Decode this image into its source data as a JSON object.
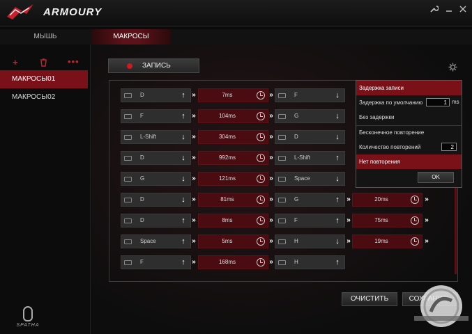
{
  "app": {
    "title": "ARMOURY"
  },
  "titlebar": {
    "tools_icon": "wrench-icon",
    "minimize_icon": "minimize-icon",
    "close_icon": "close-icon"
  },
  "tabs": [
    {
      "label": "МЫШЬ"
    },
    {
      "label": "МАКРОСЫ"
    }
  ],
  "sidebar": {
    "add_icon": "plus-icon",
    "delete_icon": "trash-icon",
    "more_icon": "more-dots-icon",
    "items": [
      {
        "label": "МАКРОСЫ01"
      },
      {
        "label": "МАКРОСЫ02"
      }
    ]
  },
  "record": {
    "label": "ЗАПИСЬ"
  },
  "events": [
    [
      {
        "key": "D",
        "dir": "up"
      },
      {
        "delay": "7ms"
      },
      {
        "key": "F",
        "dir": "down"
      }
    ],
    [
      {
        "key": "F",
        "dir": "up"
      },
      {
        "delay": "104ms"
      },
      {
        "key": "G",
        "dir": "down"
      }
    ],
    [
      {
        "key": "L-Shift",
        "dir": "down"
      },
      {
        "delay": "304ms"
      },
      {
        "key": "D",
        "dir": "down"
      }
    ],
    [
      {
        "key": "D",
        "dir": "down"
      },
      {
        "delay": "992ms"
      },
      {
        "key": "L-Shift",
        "dir": "up"
      }
    ],
    [
      {
        "key": "G",
        "dir": "down"
      },
      {
        "delay": "121ms"
      },
      {
        "key": "Space",
        "dir": "down"
      }
    ],
    [
      {
        "key": "D",
        "dir": "down"
      },
      {
        "delay": "81ms"
      },
      {
        "key": "G",
        "dir": "up"
      },
      {
        "delay": "20ms"
      }
    ],
    [
      {
        "key": "D",
        "dir": "up"
      },
      {
        "delay": "8ms"
      },
      {
        "key": "F",
        "dir": "up"
      },
      {
        "delay": "75ms"
      }
    ],
    [
      {
        "key": "Space",
        "dir": "up"
      },
      {
        "delay": "5ms"
      },
      {
        "key": "H",
        "dir": "down"
      },
      {
        "delay": "19ms"
      }
    ],
    [
      {
        "key": "F",
        "dir": "up"
      },
      {
        "delay": "168ms"
      },
      {
        "key": "H",
        "dir": "up"
      }
    ]
  ],
  "popup": {
    "record_delay": "Задержка записи",
    "default_delay_label": "Задержка по умолчанию",
    "default_delay_value": "1",
    "default_delay_unit": "ms",
    "no_delay": "Без задержки",
    "infinite_repeat": "Бесконечное повторение",
    "repeat_count_label": "Количество повторений",
    "repeat_count_value": "2",
    "no_repeat": "Нет повторения",
    "ok": "OK"
  },
  "buttons": {
    "clear": "ОЧИСТИТЬ",
    "save": "СОХРАНИТЬ"
  },
  "device": {
    "name": "SPATHA"
  },
  "colors": {
    "accent": "#7a1018",
    "record": "#d01822",
    "background": "#0b0b0b"
  }
}
